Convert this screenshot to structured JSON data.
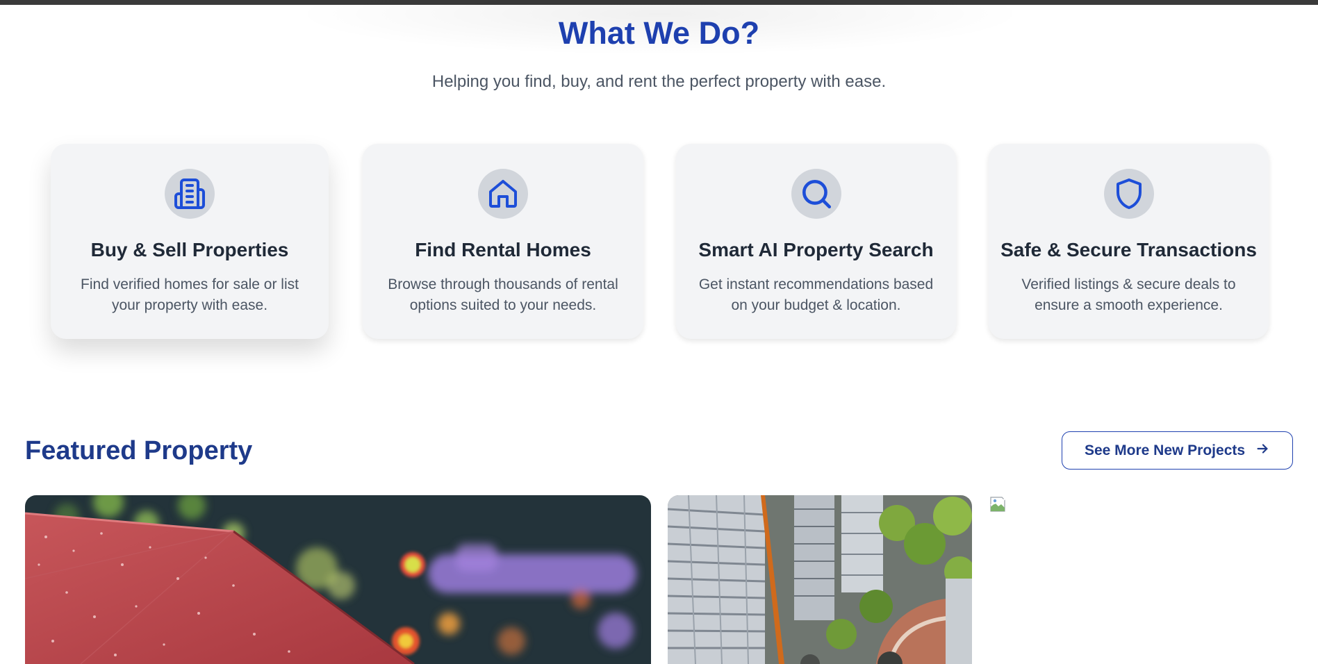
{
  "what_we_do": {
    "title": "What We Do?",
    "subtitle": "Helping you find, buy, and rent the perfect property with ease."
  },
  "services": [
    {
      "icon": "building-icon",
      "title": "Buy & Sell Properties",
      "description": "Find verified homes for sale or list your property with ease."
    },
    {
      "icon": "home-icon",
      "title": "Find Rental Homes",
      "description": "Browse through thousands of rental options suited to your needs."
    },
    {
      "icon": "search-icon",
      "title": "Smart AI Property Search",
      "description": "Get instant recommendations based on your budget & location."
    },
    {
      "icon": "shield-icon",
      "title": "Safe & Secure Transactions",
      "description": "Verified listings & secure deals to ensure a smooth experience."
    }
  ],
  "featured": {
    "title": "Featured Property",
    "see_more_label": "See More New Projects",
    "see_more_icon": "arrow-right-icon",
    "images": [
      "umbrella-night-bokeh-photo",
      "aerial-buildings-photo",
      "broken-image-icon"
    ]
  },
  "colors": {
    "accent": "#1e40af",
    "accent_dark": "#1e3a8a",
    "icon_blue": "#1d4ed8",
    "card_bg": "#f3f4f6"
  }
}
